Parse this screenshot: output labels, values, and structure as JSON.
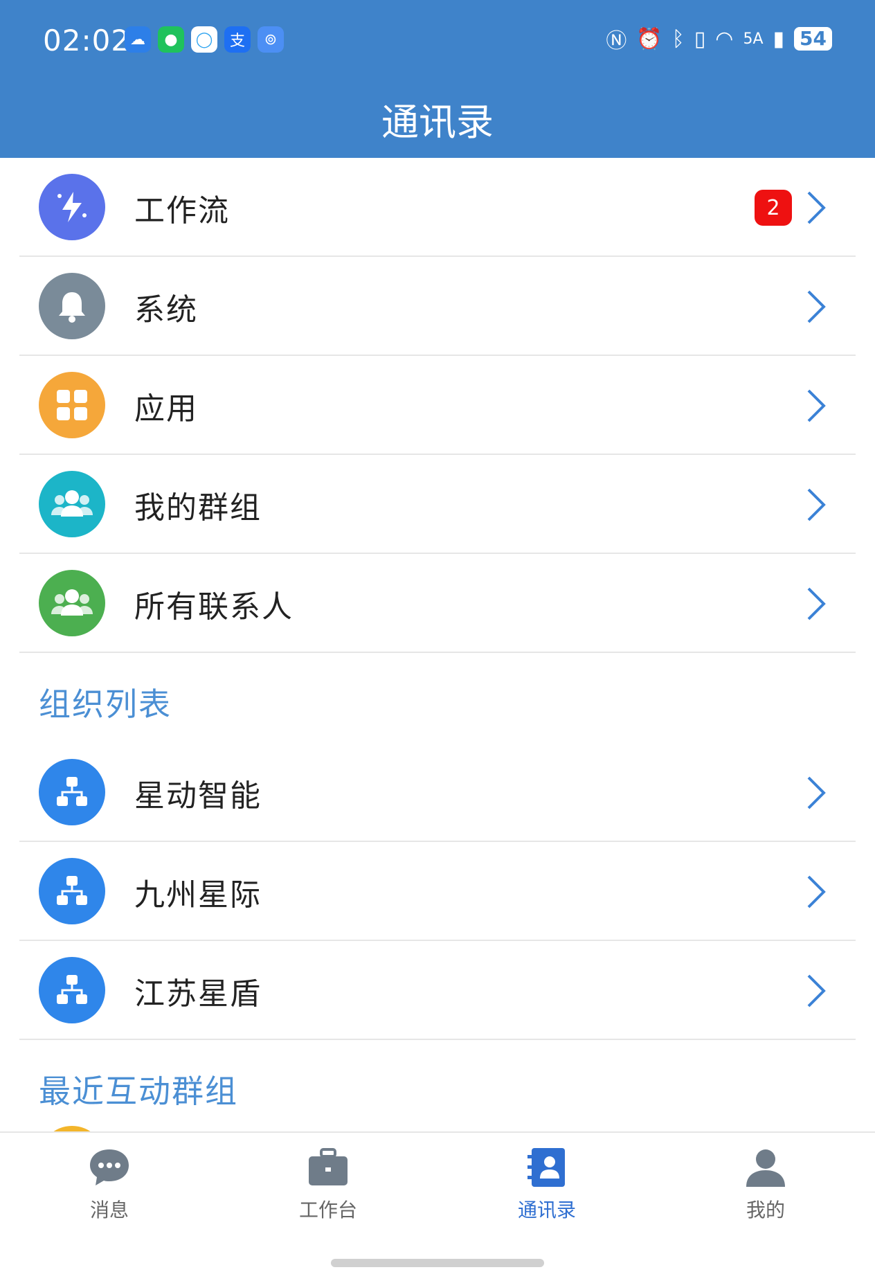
{
  "status_bar": {
    "time": "02:02",
    "network": "5A",
    "battery": "54",
    "app_icons": [
      "weather-icon",
      "wechat-icon",
      "chat-icon",
      "alipay-icon",
      "hotspot-icon"
    ]
  },
  "header": {
    "title": "通讯录"
  },
  "menu_items": [
    {
      "label": "工作流",
      "icon": "workflow-icon",
      "color": "#5a72ea",
      "badge": "2"
    },
    {
      "label": "系统",
      "icon": "bell-icon",
      "color": "#7a8b99"
    },
    {
      "label": "应用",
      "icon": "apps-grid-icon",
      "color": "#f5a73a"
    },
    {
      "label": "我的群组",
      "icon": "group-icon",
      "color": "#1cb5c8"
    },
    {
      "label": "所有联系人",
      "icon": "contacts-icon",
      "color": "#4caf50"
    }
  ],
  "sections": {
    "organizations_title": "组织列表",
    "recent_title": "最近互动群组"
  },
  "organizations": [
    {
      "label": "星动智能",
      "icon": "org-tree-icon",
      "color": "#2f86ea"
    },
    {
      "label": "九州星际",
      "icon": "org-tree-icon",
      "color": "#2f86ea"
    },
    {
      "label": "江苏星盾",
      "icon": "org-tree-icon",
      "color": "#2f86ea"
    }
  ],
  "tabbar": [
    {
      "label": "消息",
      "icon": "message-icon"
    },
    {
      "label": "工作台",
      "icon": "briefcase-icon"
    },
    {
      "label": "通讯录",
      "icon": "contacts-book-icon",
      "active": true
    },
    {
      "label": "我的",
      "icon": "person-icon"
    }
  ],
  "colors": {
    "header": "#3f83ca",
    "accent": "#4b8fd4",
    "badge": "#ee1111",
    "chevron": "#3b82d6"
  }
}
